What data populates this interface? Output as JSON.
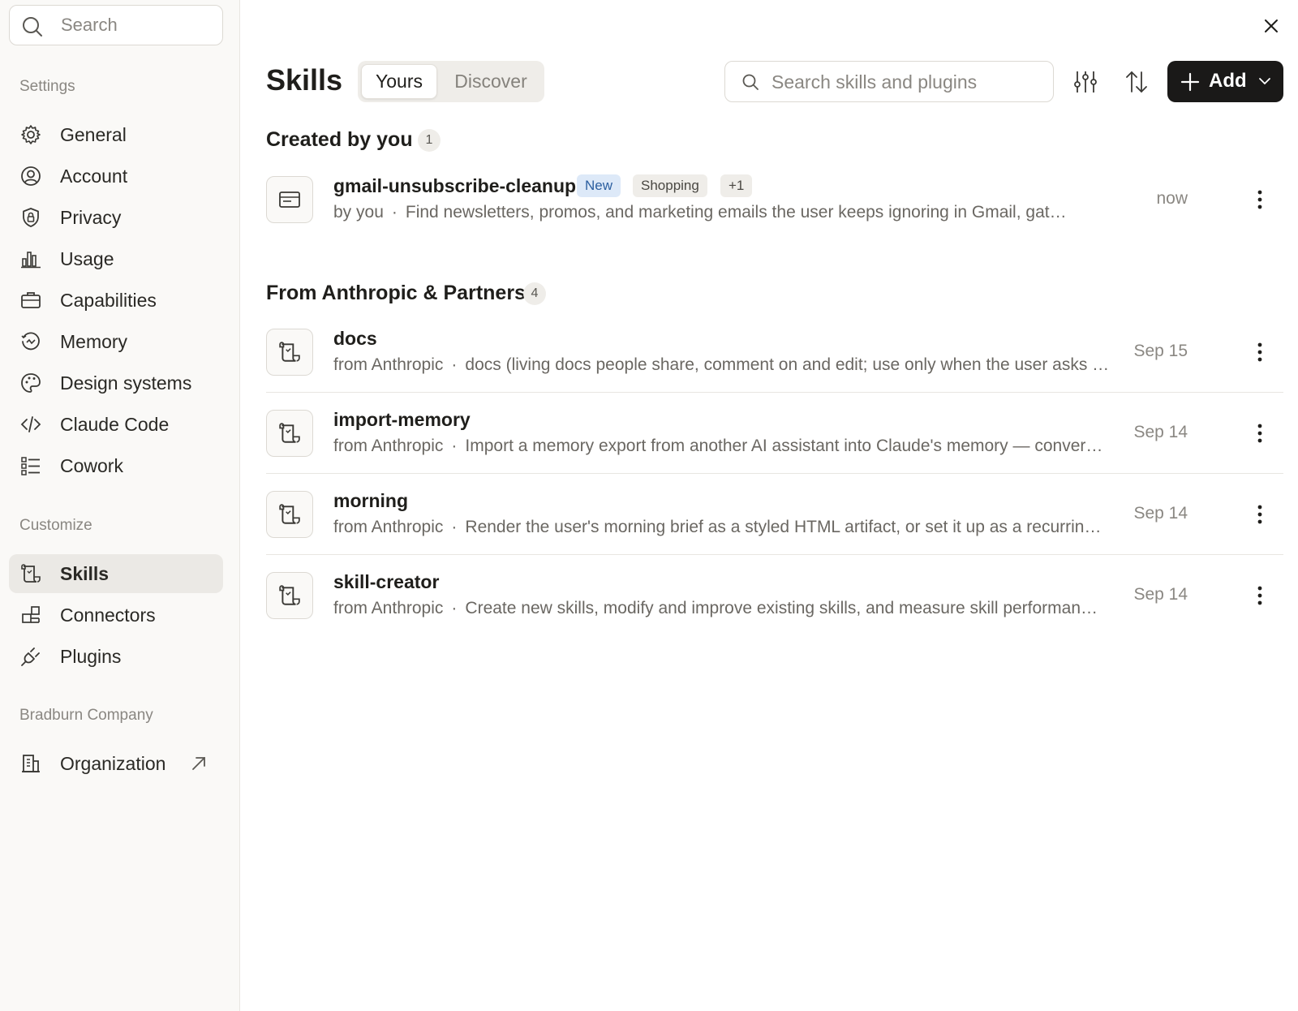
{
  "sidebar": {
    "search_placeholder": "Search",
    "sections": {
      "settings": "Settings",
      "customize": "Customize",
      "company": "Bradburn Company"
    },
    "settings_items": [
      {
        "label": "General",
        "icon": "gear-icon"
      },
      {
        "label": "Account",
        "icon": "user-circle-icon"
      },
      {
        "label": "Privacy",
        "icon": "shield-lock-icon"
      },
      {
        "label": "Usage",
        "icon": "bar-chart-icon"
      },
      {
        "label": "Capabilities",
        "icon": "briefcase-icon"
      },
      {
        "label": "Memory",
        "icon": "memory-icon"
      },
      {
        "label": "Design systems",
        "icon": "palette-icon"
      },
      {
        "label": "Claude Code",
        "icon": "code-icon"
      },
      {
        "label": "Cowork",
        "icon": "list-checks-icon"
      }
    ],
    "customize_items": [
      {
        "label": "Skills",
        "icon": "scroll-icon",
        "active": true
      },
      {
        "label": "Connectors",
        "icon": "puzzle-icon"
      },
      {
        "label": "Plugins",
        "icon": "plug-icon"
      }
    ],
    "company_items": [
      {
        "label": "Organization",
        "icon": "building-icon",
        "external": true
      }
    ]
  },
  "header": {
    "title": "Skills",
    "tabs": [
      "Yours",
      "Discover"
    ],
    "active_tab": "Yours",
    "search_placeholder": "Search skills and plugins",
    "add_label": "Add"
  },
  "groups": {
    "created": {
      "title": "Created by you",
      "count": "1"
    },
    "partners": {
      "title": "From Anthropic & Partners",
      "count": "4"
    }
  },
  "created_skills": [
    {
      "name": "gmail-unsubscribe-cleanup",
      "tags": [
        "New",
        "Shopping",
        "+1"
      ],
      "source": "by you",
      "description": "Find newsletters, promos, and marketing emails the user keeps ignoring in Gmail, gat…",
      "date": "now"
    }
  ],
  "partner_skills": [
    {
      "name": "docs",
      "source": "from Anthropic",
      "description": "docs (living docs people share, comment on and edit; use only when the user asks …",
      "date": "Sep 15"
    },
    {
      "name": "import-memory",
      "source": "from Anthropic",
      "description": "Import a memory export from another AI assistant into Claude's memory — conver…",
      "date": "Sep 14"
    },
    {
      "name": "morning",
      "source": "from Anthropic",
      "description": "Render the user's morning brief as a styled HTML artifact, or set it up as a recurrin…",
      "date": "Sep 14"
    },
    {
      "name": "skill-creator",
      "source": "from Anthropic",
      "description": "Create new skills, modify and improve existing skills, and measure skill performan…",
      "date": "Sep 14"
    }
  ],
  "meta_separator": "·"
}
